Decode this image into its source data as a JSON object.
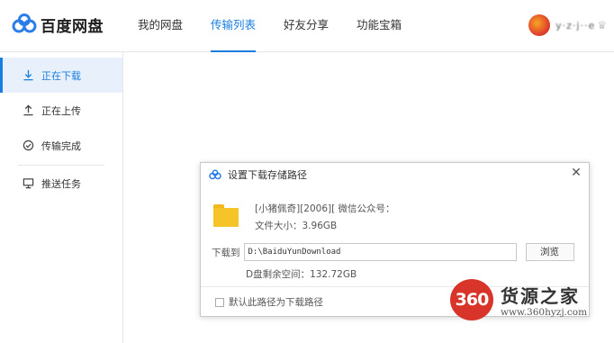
{
  "header": {
    "logo_text": "百度网盘",
    "nav": [
      {
        "label": "我的网盘",
        "active": false
      },
      {
        "label": "传输列表",
        "active": true
      },
      {
        "label": "好友分享",
        "active": false
      },
      {
        "label": "功能宝箱",
        "active": false
      }
    ],
    "username": "y·z·j··e",
    "crown_icon": "crown-icon"
  },
  "sidebar": {
    "items": [
      {
        "label": "正在下载",
        "icon": "download-icon",
        "active": true
      },
      {
        "label": "正在上传",
        "icon": "upload-icon",
        "active": false
      },
      {
        "label": "传输完成",
        "icon": "check-circle-icon",
        "active": false
      },
      {
        "label": "推送任务",
        "icon": "monitor-icon",
        "active": false
      }
    ]
  },
  "dialog": {
    "title": "设置下载存储路径",
    "close_symbol": "✕",
    "file_name": "[小猪佩奇][2006][ 微信公众号：",
    "file_size": "文件大小：3.96GB",
    "path_label": "下载到",
    "path_value": "D:\\BaiduYunDownload",
    "browse_label": "浏览",
    "free_space": "D盘剩余空间：132.72GB",
    "default_checkbox_label": "默认此路径为下载路径",
    "default_checked": false
  },
  "watermark": {
    "badge": "360",
    "name": "货源之家",
    "url": "www.360hyzj.com"
  },
  "colors": {
    "accent": "#1a7ee0",
    "active_bg": "#e8f1fb",
    "folder": "#f5c428",
    "watermark_red": "#d8342a"
  }
}
